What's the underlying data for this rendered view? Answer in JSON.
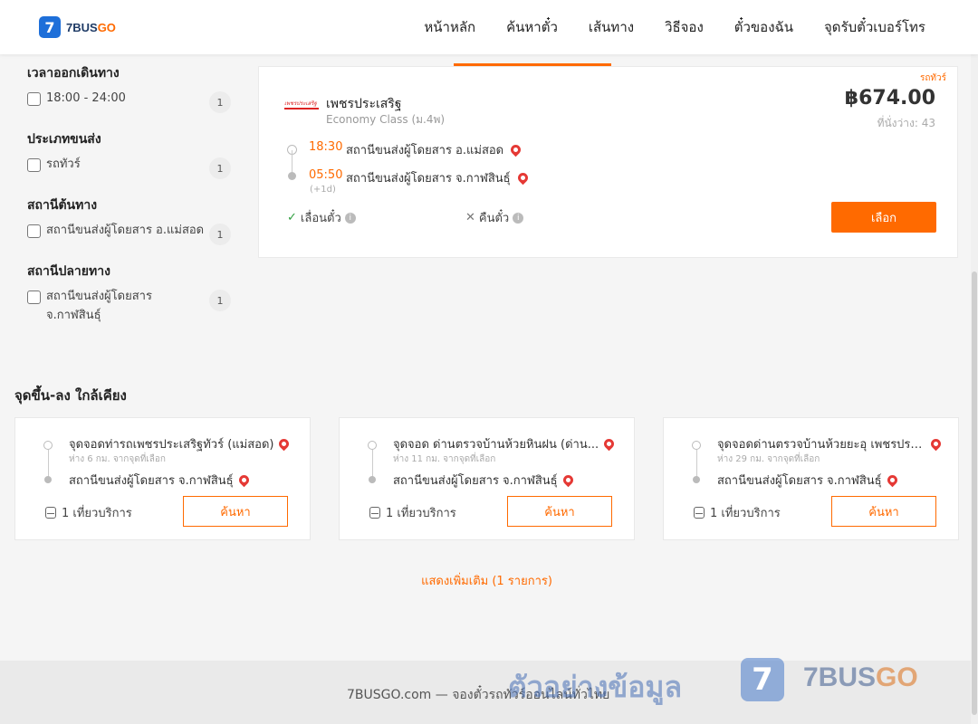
{
  "brand": {
    "name_main": "7BUS",
    "name_accent": "GO",
    "badge": "7"
  },
  "nav": [
    "หน้าหลัก",
    "ค้นหาตั๋ว",
    "เส้นทาง",
    "วิธีจอง",
    "ตั๋วของฉัน",
    "จุดรับตั๋วเบอร์โทร"
  ],
  "filters": [
    {
      "title": "เวลาออกเดินทาง",
      "items": [
        {
          "label": "18:00 - 24:00",
          "count": "1"
        }
      ]
    },
    {
      "title": "ประเภทขนส่ง",
      "items": [
        {
          "label": "รถทัวร์",
          "count": "1"
        }
      ]
    },
    {
      "title": "สถานีต้นทาง",
      "items": [
        {
          "label": "สถานีขนส่งผู้โดยสาร อ.แม่สอด",
          "count": "1"
        }
      ]
    },
    {
      "title": "สถานีปลายทาง",
      "items": [
        {
          "label": "สถานีขนส่งผู้โดยสาร จ.กาฬสินธุ์",
          "count": "1"
        }
      ]
    }
  ],
  "trip": {
    "tag": "รถทัวร์",
    "operator_logo_text": "เพชรประเสริฐ",
    "operator": "เพชรประเสริฐ",
    "class": "Economy Class (ม.4พ)",
    "price": "฿674.00",
    "seats": "ที่นั่งว่าง: 43",
    "depart_time": "18:30",
    "depart_station": "สถานีขนส่งผู้โดยสาร อ.แม่สอด",
    "arrive_time": "05:50",
    "arrive_station": "สถานีขนส่งผู้โดยสาร จ.กาฬสินธุ์",
    "plus_day": "(+1d)",
    "reschedule": "เลื่อนตั๋ว",
    "refund": "คืนตั๋ว",
    "select": "เลือก"
  },
  "nearby": {
    "title": "จุดขึ้น-ลง ใกล้เคียง",
    "cards": [
      {
        "from": "จุดจอดท่ารถเพชรประเสริฐทัวร์ (แม่สอด)",
        "distance": "ห่าง 6 กม. จากจุดที่เลือก",
        "to": "สถานีขนส่งผู้โดยสาร จ.กาฬสินธุ์",
        "service": "1 เที่ยวบริการ",
        "button": "ค้นหา"
      },
      {
        "from": "จุดจอด ด่านตรวจบ้านห้วยหินฝน (ด่าน...",
        "distance": "ห่าง 11 กม. จากจุดที่เลือก",
        "to": "สถานีขนส่งผู้โดยสาร จ.กาฬสินธุ์",
        "service": "1 เที่ยวบริการ",
        "button": "ค้นหา"
      },
      {
        "from": "จุดจอดด่านตรวจบ้านห้วยยะอุ เพชรประ...",
        "distance": "ห่าง 29 กม. จากจุดที่เลือก",
        "to": "สถานีขนส่งผู้โดยสาร จ.กาฬสินธุ์",
        "service": "1 เที่ยวบริการ",
        "button": "ค้นหา"
      }
    ],
    "more": "แสดงเพิ่มเติม (1 รายการ)"
  },
  "footer": {
    "text": "7BUSGO.com — จองตั๋วรถทัวร์ออนไลน์ทั่วไทย",
    "watermark": "ตัวอย่างข้อมูล",
    "watermark_badge": "7",
    "watermark_brand_main": "7BUS",
    "watermark_brand_accent": "GO"
  },
  "colors": {
    "accent": "#ff6a00",
    "brand_blue": "#1e6fd9",
    "pin": "#e53935"
  }
}
